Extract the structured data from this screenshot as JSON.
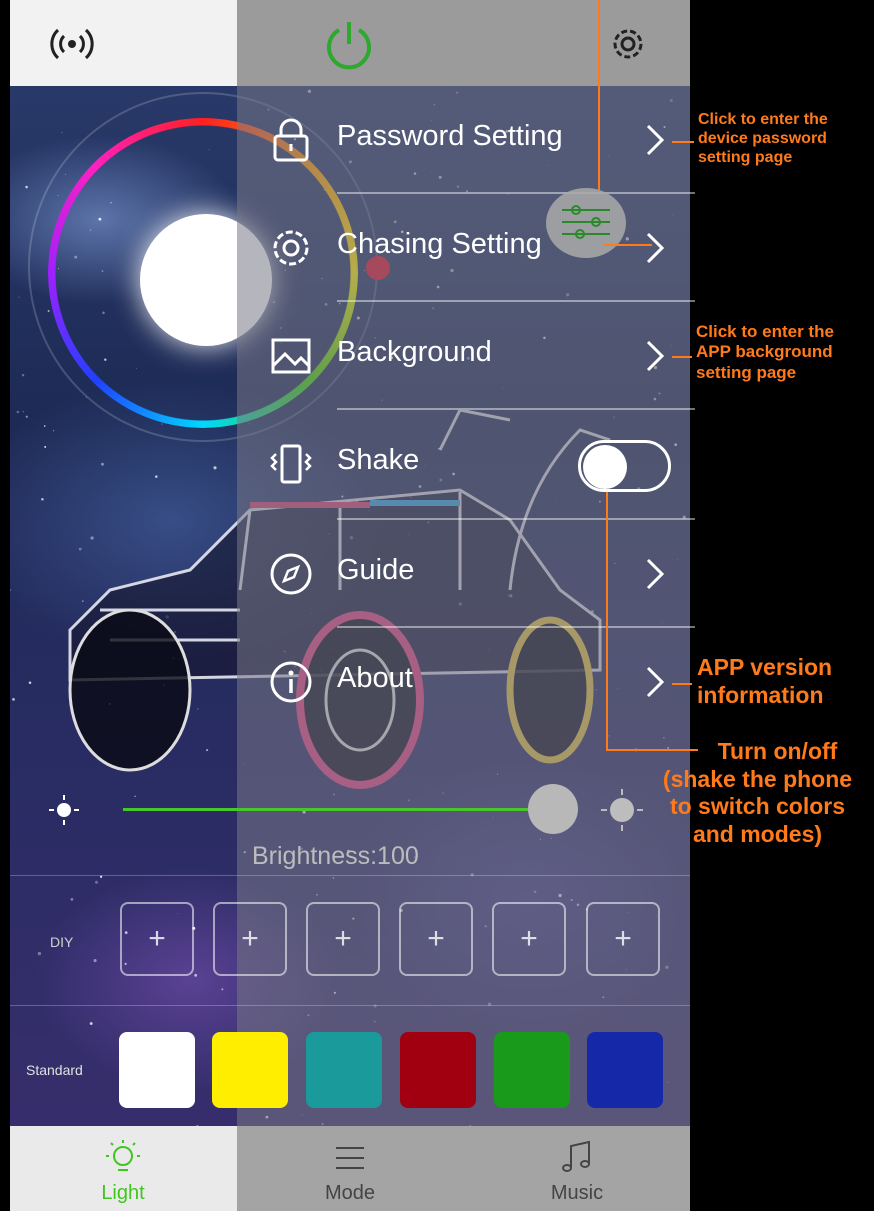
{
  "header": {
    "signal_icon": "wireless-signal-icon",
    "power_icon": "power-icon",
    "settings_icon": "gear-icon"
  },
  "menu": {
    "items": [
      {
        "label": "Password Setting",
        "icon": "lock-icon"
      },
      {
        "label": "Chasing Setting",
        "icon": "gear-icon"
      },
      {
        "label": "Background",
        "icon": "image-icon"
      },
      {
        "label": "Shake",
        "icon": "shake-phone-icon",
        "toggle_on": true
      },
      {
        "label": "Guide",
        "icon": "compass-icon"
      },
      {
        "label": "About",
        "icon": "info-icon"
      }
    ]
  },
  "brightness": {
    "label": "Brightness:100",
    "value": 100
  },
  "diy": {
    "label": "DIY",
    "slots": [
      "+",
      "+",
      "+",
      "+",
      "+",
      "+"
    ]
  },
  "standard": {
    "label": "Standard",
    "colors": [
      "#ffffff",
      "#ffee00",
      "#1a9a9a",
      "#a00010",
      "#1a9a1a",
      "#1428a8"
    ]
  },
  "tabs": [
    {
      "label": "Light",
      "icon": "lightbulb-icon",
      "active": true,
      "color": "#3fc71e"
    },
    {
      "label": "Mode",
      "icon": "menu-lines-icon",
      "active": false,
      "color": "#444444"
    },
    {
      "label": "Music",
      "icon": "music-note-icon",
      "active": false,
      "color": "#444444"
    }
  ],
  "annotations": {
    "password": "Click to enter the device password setting page",
    "password_lines": [
      "Click to enter the",
      "device password",
      "setting page"
    ],
    "background_lines": [
      "Click to enter the",
      "APP background",
      "setting page"
    ],
    "about_lines": [
      "APP version",
      "information"
    ],
    "shake_lines": [
      "Turn on/off",
      "(shake the phone",
      "to switch colors",
      "and modes)"
    ]
  },
  "colors": {
    "annotation": "#ff7a1a",
    "accent_green": "#3fc71e"
  }
}
